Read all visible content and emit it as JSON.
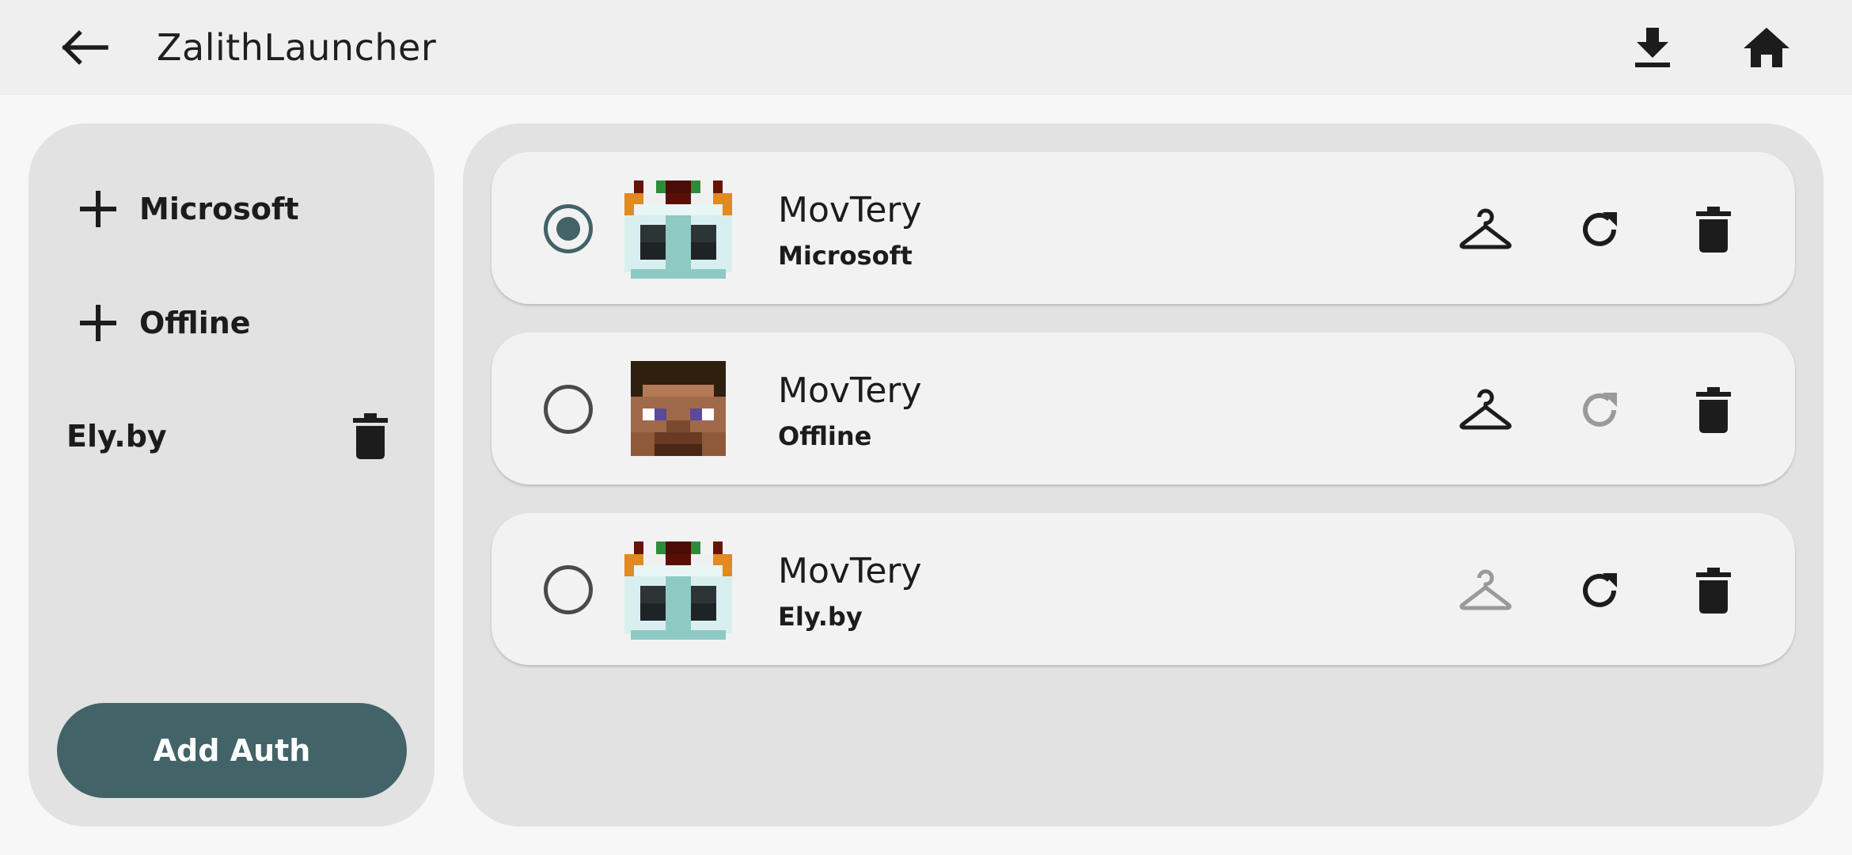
{
  "app": {
    "title": "ZalithLauncher"
  },
  "colors": {
    "accent": "#426367",
    "icon": "#1c1c1c",
    "disabled": "#9a9a9a"
  },
  "sidebar": {
    "add_items": [
      {
        "label": "Microsoft",
        "icon": "plus-icon"
      },
      {
        "label": "Offline",
        "icon": "plus-icon"
      }
    ],
    "servers": [
      {
        "label": "Ely.by",
        "icon": "trash-icon"
      }
    ],
    "add_auth_label": "Add Auth"
  },
  "accounts": [
    {
      "name": "MovTery",
      "type": "Microsoft",
      "selected": true,
      "skin_enabled": true,
      "refresh_enabled": true,
      "avatar": "custom-skin-avatar"
    },
    {
      "name": "MovTery",
      "type": "Offline",
      "selected": false,
      "skin_enabled": true,
      "refresh_enabled": false,
      "avatar": "steve-avatar"
    },
    {
      "name": "MovTery",
      "type": "Ely.by",
      "selected": false,
      "skin_enabled": false,
      "refresh_enabled": true,
      "avatar": "custom-skin-avatar"
    }
  ]
}
